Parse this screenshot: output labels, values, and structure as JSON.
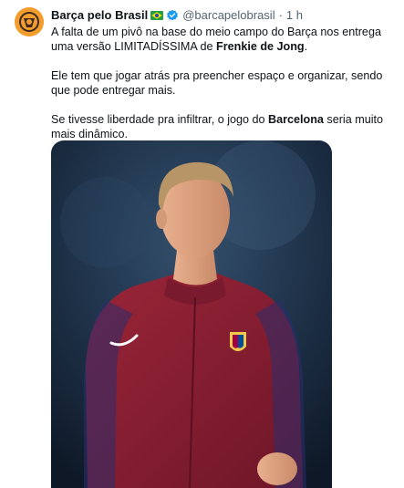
{
  "post": {
    "author_name": "Barça pelo Brasil",
    "handle": "@barcapelobrasil",
    "separator": "·",
    "time": "1 h",
    "paragraph1": {
      "part1": "A falta de um pivô na base do meio campo do Barça nos entrega uma versão LIMITADÍSSIMA de ",
      "bold": "Frenkie de Jong",
      "part2": "."
    },
    "paragraph2": "Ele tem que jogar atrás pra preencher espaço e organizar, sendo que pode entregar mais.",
    "paragraph3": {
      "part1": "Se tivesse liberdade pra infiltrar, o jogo do ",
      "bold": "Barcelona",
      "part2": " seria muito mais dinâmico."
    },
    "media": {
      "subject": "player-photo",
      "background": "#1c2e44",
      "jacket_color": "#8a1f35",
      "sleeve_stripe_color": "#2a2d6e"
    }
  },
  "icons": {
    "avatar": "barca-logo-avatar",
    "flag": "brazil-flag-icon",
    "verified": "verified-badge-icon",
    "verified_color": "#1d9bf0"
  }
}
